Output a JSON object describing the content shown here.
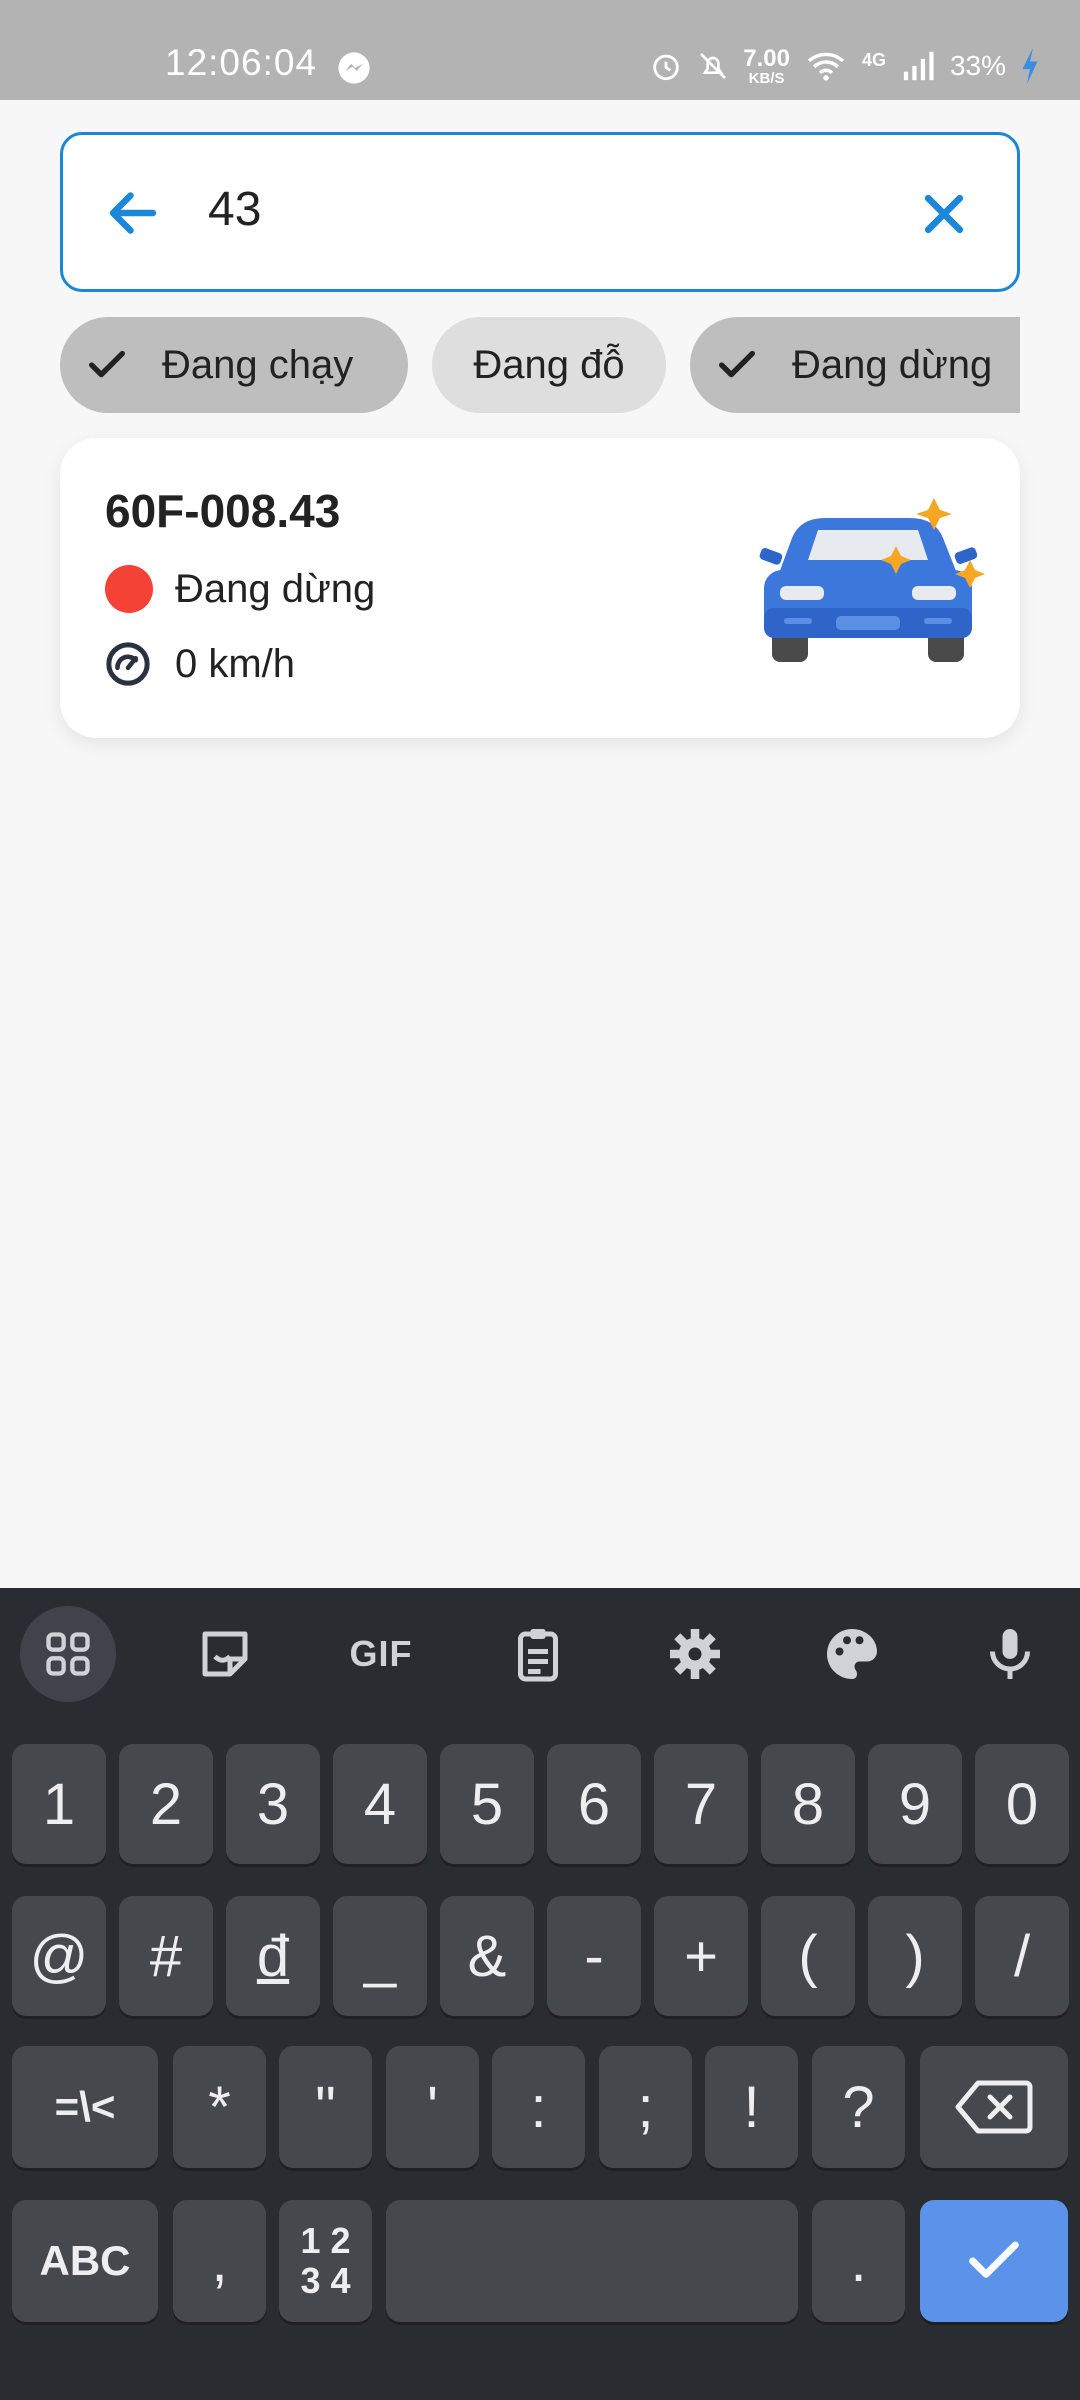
{
  "status_bar": {
    "time": "12:06:04",
    "net_speed_value": "7.00",
    "net_speed_unit": "KB/S",
    "network": "4G",
    "battery": "33%"
  },
  "search": {
    "query": "43"
  },
  "filters": [
    {
      "label": "Đang chạy",
      "selected": true
    },
    {
      "label": "Đang đỗ",
      "selected": false
    },
    {
      "label": "Đang dừng",
      "selected": true
    }
  ],
  "vehicle": {
    "plate": "60F-008.43",
    "status": "Đang dừng",
    "status_color": "#f44336",
    "speed": "0 km/h"
  },
  "keyboard": {
    "toolbar": [
      "apps-icon",
      "sticker-icon",
      "GIF",
      "clipboard-icon",
      "settings-icon",
      "palette-icon",
      "microphone-icon"
    ],
    "gif_label": "GIF",
    "row1": [
      "1",
      "2",
      "3",
      "4",
      "5",
      "6",
      "7",
      "8",
      "9",
      "0"
    ],
    "row2": [
      "@",
      "#",
      "đ",
      "_",
      "&",
      "-",
      "+",
      "(",
      ")",
      "/"
    ],
    "row3": [
      "=\\<",
      "*",
      "\"",
      "'",
      ":",
      ";",
      "!",
      "?"
    ],
    "abc": "ABC",
    "comma": ",",
    "numpad_top": "1 2",
    "numpad_bottom": "3 4",
    "period": "."
  },
  "colors": {
    "accent": "#1b87d6",
    "keyboard_bg": "#292c30",
    "key_bg": "#45484d",
    "done_key": "#5c93ea"
  }
}
